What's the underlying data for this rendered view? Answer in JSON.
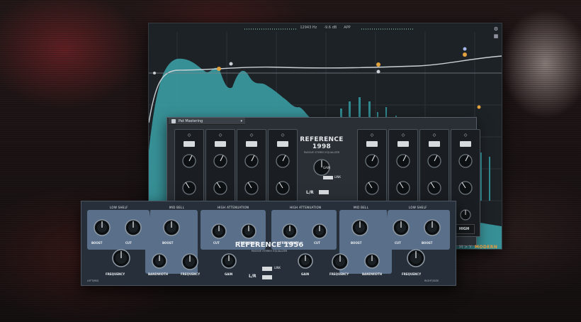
{
  "analyzer": {
    "readout_freq": "12943 Hz",
    "readout_gain": "-9.6 dB",
    "readout_extra": "APP"
  },
  "panel_1998": {
    "preset_name": "Pat Mastering",
    "title": "REFERENCE 1998",
    "subtitle": "PASSIVE STEREO EQUALIZER",
    "gain_label": "GAIN",
    "link_label": "LINK",
    "lr_label": "L/R",
    "hi_label": "HIGH",
    "mode_modern": "MODERN",
    "mode_m": "M > Y",
    "band_symbols": [
      "◇",
      "◇",
      "◇",
      "◇",
      "◇",
      "◇",
      "◇",
      "◇"
    ]
  },
  "panel_1956": {
    "title": "REFERENCE 1956",
    "subtitle": "PASSIVE STEREO EQUALIZER",
    "sections": {
      "low_shelf_left": "LOW SHELF",
      "mid_bell_left": "MID BELL",
      "high_atten_left": "HIGH ATTENUATION",
      "high_atten_right": "HIGH ATTENUATION",
      "mid_bell_right": "MID BELL",
      "low_shelf_right": "LOW SHELF"
    },
    "knobs": {
      "boost": "BOOST",
      "cut": "CUT",
      "frequency": "FREQUENCY",
      "bandwidth": "BANDWIDTH",
      "gain": "GAIN"
    },
    "link_label": "LINK",
    "lr_label": "L/R",
    "corner_left": "LEFT/MID",
    "corner_right": "RIGHT/SIDE"
  },
  "colors": {
    "spectrum_fill": "#3a9aa0",
    "accent_orange": "#e79a3c",
    "panel_blue": "#5a6f8a"
  }
}
